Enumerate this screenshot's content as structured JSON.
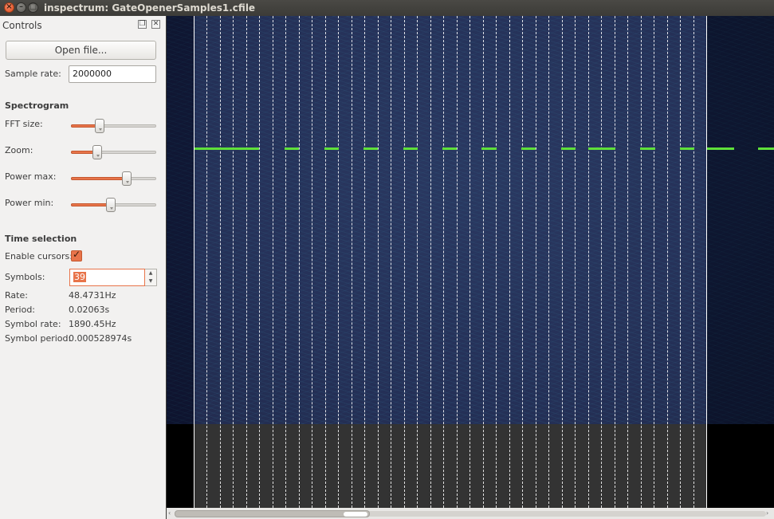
{
  "window": {
    "title": "inspectrum: GateOpenerSamples1.cfile",
    "close_glyph": "×",
    "minimize_glyph": "–",
    "maximize_glyph": "□"
  },
  "dock": {
    "title": "Controls",
    "float_glyph": "❐",
    "close_glyph": "✕"
  },
  "controls": {
    "open_file_label": "Open file...",
    "sample_rate_label": "Sample rate:",
    "sample_rate_value": "2000000",
    "spectrogram_section": "Spectrogram",
    "fft_size_label": "FFT size:",
    "fft_size_level": 0.34,
    "zoom_label": "Zoom:",
    "zoom_level": 0.31,
    "power_max_label": "Power max:",
    "power_max_level": 0.65,
    "power_min_label": "Power min:",
    "power_min_level": 0.47,
    "time_selection_section": "Time selection",
    "enable_cursors_label": "Enable cursors:",
    "enable_cursors_checked": true,
    "check_glyph": "✓",
    "symbols_label": "Symbols:",
    "symbols_value": "39",
    "spin_up_glyph": "▲",
    "spin_down_glyph": "▼",
    "rate_label": "Rate:",
    "rate_value": "48.4731Hz",
    "period_label": "Period:",
    "period_value": "0.02063s",
    "symbol_rate_label": "Symbol rate:",
    "symbol_rate_value": "1890.45Hz",
    "symbol_period_label": "Symbol period:",
    "symbol_period_value": "0.000528974s"
  },
  "scrollbar": {
    "left_glyph": "‹",
    "right_glyph": "›"
  },
  "colors": {
    "accent": "#e8744a",
    "signal": "#5fe03a",
    "spectrogram_bg": "#17234a",
    "cursor": "#ffffff"
  }
}
